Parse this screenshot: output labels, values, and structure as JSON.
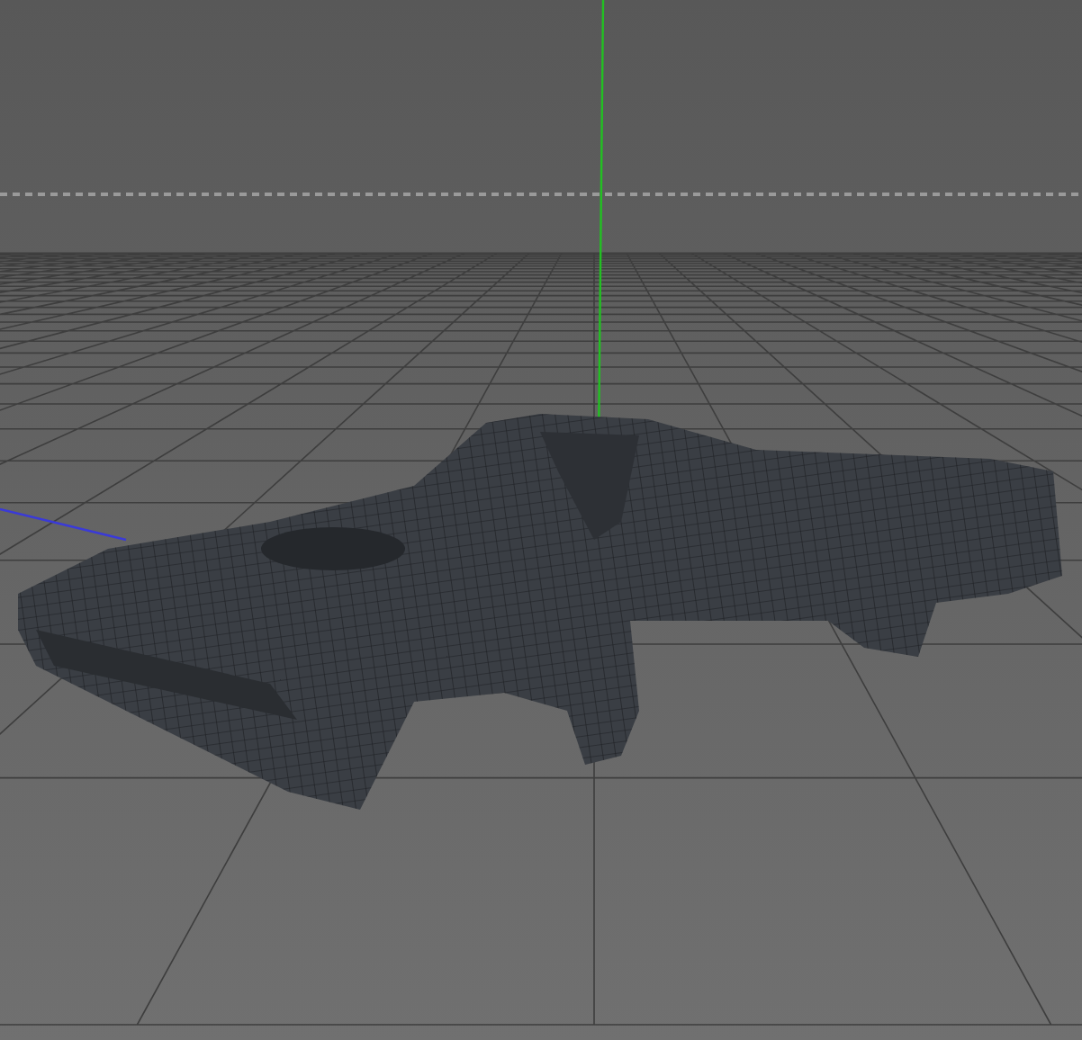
{
  "viewport": {
    "grid_visible": true,
    "axes_visible": true,
    "horizon_visible": true
  }
}
